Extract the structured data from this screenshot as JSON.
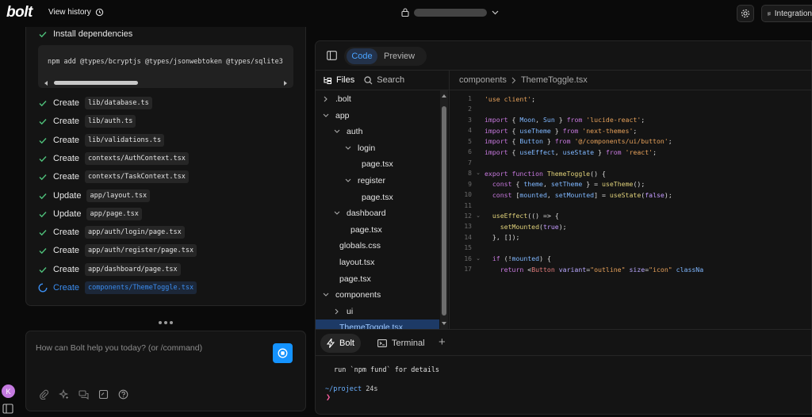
{
  "topbar": {
    "logo": "bolt",
    "view_history": "View history",
    "integrations": "Integrations"
  },
  "steps": {
    "install_label": "Install dependencies",
    "command": "npm add @types/bcryptjs @types/jsonwebtoken @types/sqlite3",
    "items": [
      {
        "verb": "Create",
        "file": "lib/database.ts",
        "status": "done"
      },
      {
        "verb": "Create",
        "file": "lib/auth.ts",
        "status": "done"
      },
      {
        "verb": "Create",
        "file": "lib/validations.ts",
        "status": "done"
      },
      {
        "verb": "Create",
        "file": "contexts/AuthContext.tsx",
        "status": "done"
      },
      {
        "verb": "Create",
        "file": "contexts/TaskContext.tsx",
        "status": "done"
      },
      {
        "verb": "Update",
        "file": "app/layout.tsx",
        "status": "done"
      },
      {
        "verb": "Update",
        "file": "app/page.tsx",
        "status": "done"
      },
      {
        "verb": "Create",
        "file": "app/auth/login/page.tsx",
        "status": "done"
      },
      {
        "verb": "Create",
        "file": "app/auth/register/page.tsx",
        "status": "done"
      },
      {
        "verb": "Create",
        "file": "app/dashboard/page.tsx",
        "status": "done"
      },
      {
        "verb": "Create",
        "file": "components/ThemeToggle.tsx",
        "status": "in-progress"
      }
    ]
  },
  "prompt": {
    "placeholder": "How can Bolt help you today? (or /command)"
  },
  "user": {
    "initial": "K"
  },
  "workbench": {
    "tabs": {
      "code": "Code",
      "preview": "Preview"
    },
    "files_label": "Files",
    "search_label": "Search",
    "tree": [
      {
        "name": ".bolt",
        "type": "folder",
        "open": false,
        "depth": 0
      },
      {
        "name": "app",
        "type": "folder",
        "open": true,
        "depth": 0
      },
      {
        "name": "auth",
        "type": "folder",
        "open": true,
        "depth": 1
      },
      {
        "name": "login",
        "type": "folder",
        "open": true,
        "depth": 2
      },
      {
        "name": "page.tsx",
        "type": "file",
        "depth": 3
      },
      {
        "name": "register",
        "type": "folder",
        "open": true,
        "depth": 2
      },
      {
        "name": "page.tsx",
        "type": "file",
        "depth": 3
      },
      {
        "name": "dashboard",
        "type": "folder",
        "open": true,
        "depth": 1
      },
      {
        "name": "page.tsx",
        "type": "file",
        "depth": 2
      },
      {
        "name": "globals.css",
        "type": "file",
        "depth": 1
      },
      {
        "name": "layout.tsx",
        "type": "file",
        "depth": 1
      },
      {
        "name": "page.tsx",
        "type": "file",
        "depth": 1
      },
      {
        "name": "components",
        "type": "folder",
        "open": true,
        "depth": 0
      },
      {
        "name": "ui",
        "type": "folder",
        "open": false,
        "depth": 1
      },
      {
        "name": "ThemeToggle.tsx",
        "type": "file",
        "depth": 1,
        "active": true
      }
    ],
    "breadcrumb": {
      "folder": "components",
      "file": "ThemeToggle.tsx"
    },
    "code_lines": [
      "'use client';",
      "",
      "import { Moon, Sun } from 'lucide-react';",
      "import { useTheme } from 'next-themes';",
      "import { Button } from '@/components/ui/button';",
      "import { useEffect, useState } from 'react';",
      "",
      "export function ThemeToggle() {",
      "  const { theme, setTheme } = useTheme();",
      "  const [mounted, setMounted] = useState(false);",
      "",
      "  useEffect(() => {",
      "    setMounted(true);",
      "  }, []);",
      "",
      "  if (!mounted) {",
      "    return <Button variant=\"outline\" size=\"icon\" classNa"
    ],
    "fold_lines": [
      8,
      12,
      16
    ],
    "terminal": {
      "tabs": {
        "bolt": "Bolt",
        "terminal": "Terminal"
      },
      "line1": "run `npm fund` for details",
      "path": "~/project",
      "time": "24s",
      "prompt_char": "❯"
    }
  },
  "colors": {
    "accent": "#1493ff",
    "check": "#4ec07a",
    "active_file": "#1d3a66"
  }
}
